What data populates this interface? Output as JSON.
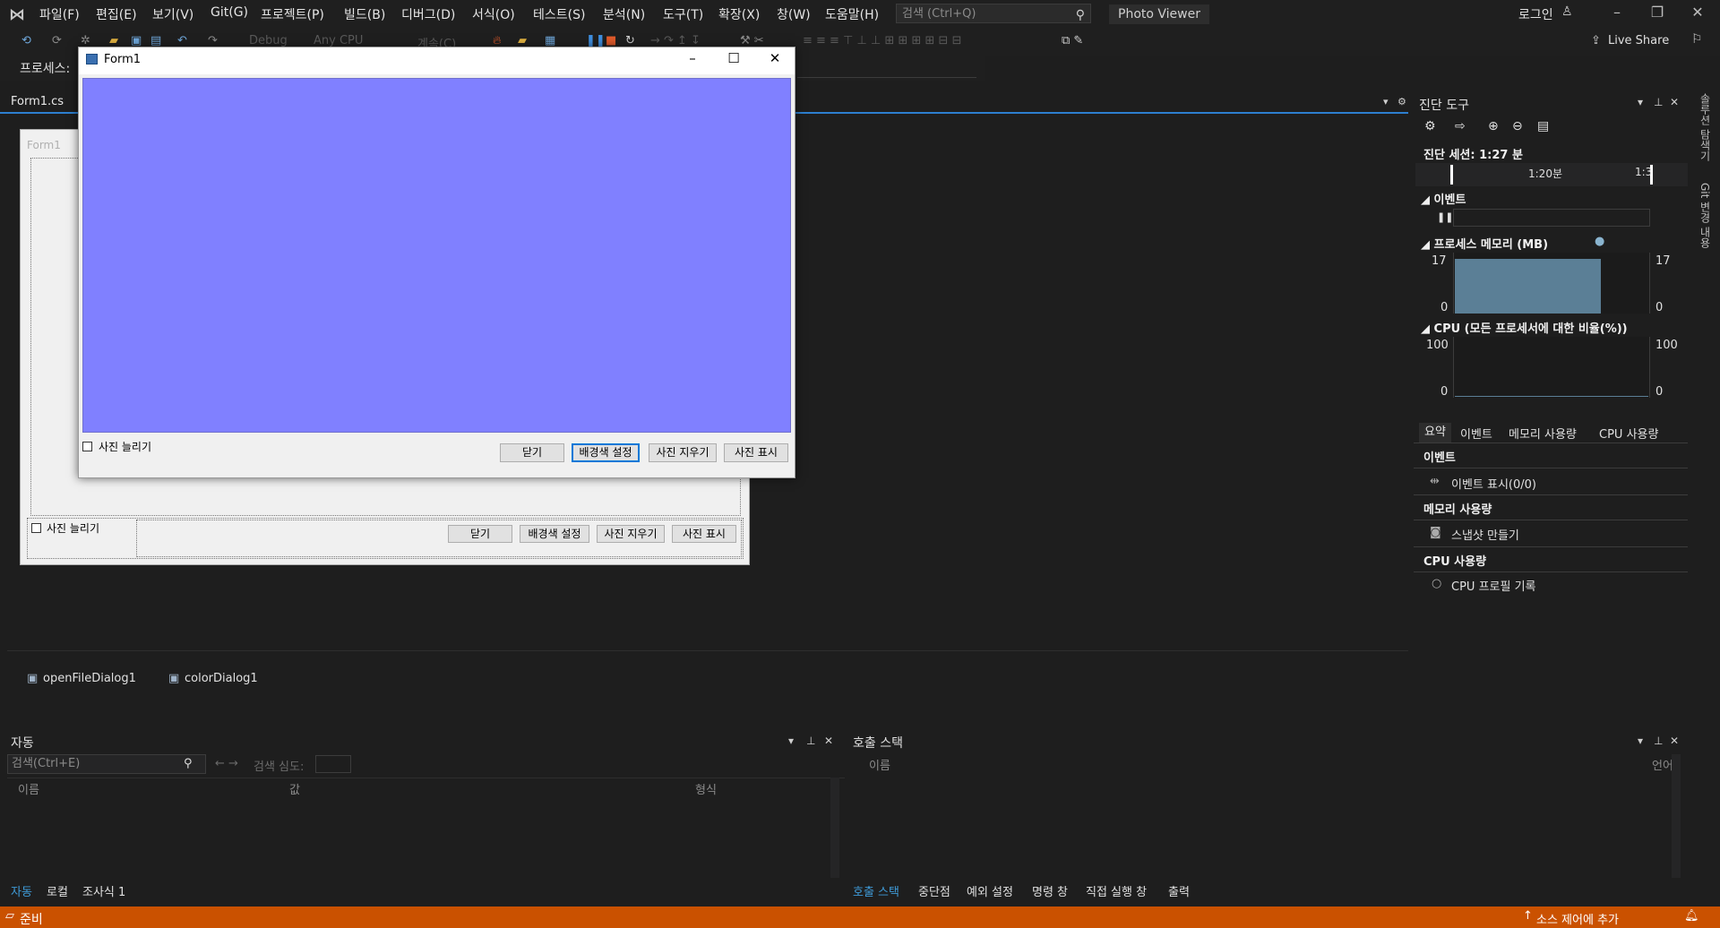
{
  "menu": {
    "items": [
      "파일(F)",
      "편집(E)",
      "보기(V)",
      "Git(G)",
      "프로젝트(P)",
      "빌드(B)",
      "디버그(D)",
      "서식(O)",
      "테스트(S)",
      "분석(N)",
      "도구(T)",
      "확장(X)",
      "창(W)",
      "도움말(H)"
    ],
    "search_placeholder": "검색 (Ctrl+Q)",
    "app_title": "Photo Viewer",
    "login": "로그인"
  },
  "toolbar": {
    "config": "Debug",
    "platform": "Any CPU",
    "continue": "계속(C)",
    "live_share": "Live Share",
    "process_label": "프로세스:"
  },
  "document": {
    "tab": "Form1.cs"
  },
  "design_form": {
    "title": "Form1",
    "checkbox_label": "사진 늘리기",
    "buttons": [
      "닫기",
      "배경색 설정",
      "사진 지우기",
      "사진 표시"
    ]
  },
  "tray": {
    "items": [
      "openFileDialog1",
      "colorDialog1"
    ]
  },
  "run_form": {
    "title": "Form1",
    "checkbox_label": "사진 늘리기",
    "buttons": [
      "닫기",
      "배경색 설정",
      "사진 지우기",
      "사진 표시"
    ],
    "picture_color": "#8080ff"
  },
  "diagnostics": {
    "title": "진단 도구",
    "session": "진단 세션: 1:27 분",
    "tick1": "1:20분",
    "tick2": "1:3",
    "section_events": "이벤트",
    "section_memory": "프로세스 메모리 (MB)",
    "memory_max": "17",
    "memory_min": "0",
    "section_cpu": "CPU (모든 프로세서에 대한 비율(%))",
    "cpu_max": "100",
    "cpu_min": "0",
    "tabs": [
      "요약",
      "이벤트",
      "메모리 사용량",
      "CPU 사용량"
    ],
    "events_header": "이벤트",
    "events_item": "이벤트 표시(0/0)",
    "memory_header": "메모리 사용량",
    "memory_item": "스냅샷 만들기",
    "cpu_header": "CPU 사용량",
    "cpu_item": "CPU 프로필 기록",
    "memory_fill": 1.0
  },
  "side_tabs": [
    "솔루션 탐색기",
    "Git 변경 내용"
  ],
  "auto_panel": {
    "title": "자동",
    "search_placeholder": "검색(Ctrl+E)",
    "depth_label": "검색 심도:",
    "columns": [
      "이름",
      "값",
      "형식"
    ],
    "tabs": [
      "자동",
      "로컬",
      "조사식 1"
    ]
  },
  "callstack_panel": {
    "title": "호출 스택",
    "columns": [
      "이름",
      "언어"
    ],
    "tabs": [
      "호출 스택",
      "중단점",
      "예외 설정",
      "명령 창",
      "직접 실행 창",
      "출력"
    ]
  },
  "status": {
    "ready": "준비",
    "source_control": "소스 제어에 추가"
  }
}
